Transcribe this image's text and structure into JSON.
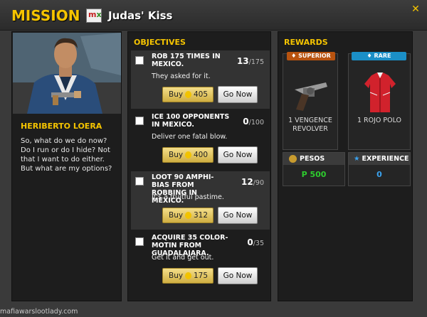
{
  "header": {
    "mission_label": "MISSION :",
    "logo_text_m": "m",
    "logo_text_x": "x",
    "mission_title": "Judas' Kiss",
    "close_symbol": "✕"
  },
  "character": {
    "name": "HERIBERTO LOERA",
    "dialogue": "So, what do we do now? Do I run or do I hide? Not that I want to do either. But what are my options?"
  },
  "objectives": {
    "title": "OBJECTIVES",
    "jobs": [
      {
        "title": "ROB 175 TIMES IN MEXICO.",
        "desc": "They asked for it.",
        "count": "13",
        "total": "/175",
        "buy_label": "Buy",
        "buy_price": "405",
        "go_label": "Go Now"
      },
      {
        "title": "ICE 100 OPPONENTS IN MEXICO.",
        "desc": "Deliver one fatal blow.",
        "count": "0",
        "total": "/100",
        "buy_label": "Buy",
        "buy_price": "400",
        "go_label": "Go Now"
      },
      {
        "title": "LOOT 90 AMPHI-BIAS FROM ROBBING IN MEXICO.",
        "desc": "It's a fruitful pastime.",
        "count": "12",
        "total": "/90",
        "buy_label": "Buy",
        "buy_price": "312",
        "go_label": "Go Now"
      },
      {
        "title": "ACQUIRE 35 COLOR-MOTIN FROM GUADALAJARA.",
        "desc": "Get it and get out.",
        "count": "0",
        "total": "/35",
        "buy_label": "Buy",
        "buy_price": "175",
        "go_label": "Go Now"
      }
    ]
  },
  "rewards": {
    "title": "REWARDS",
    "items": [
      {
        "tier": "SUPERIOR",
        "tier_color": "#b8530f",
        "name_line1": "1 VENGENCE",
        "name_line2": "REVOLVER",
        "icon": "revolver-icon"
      },
      {
        "tier": "RARE",
        "tier_color": "#1b8fc7",
        "name_line1": "1 ROJO POLO",
        "name_line2": "",
        "icon": "red-jacket-icon"
      }
    ],
    "pesos_label": "PESOS",
    "pesos_value": "P 500",
    "pesos_color": "#2ecc2e",
    "exp_label": "EXPERIENCE",
    "exp_value": "0",
    "exp_color": "#3aa2ee"
  },
  "watermark": "mafiawarslootlady.com"
}
